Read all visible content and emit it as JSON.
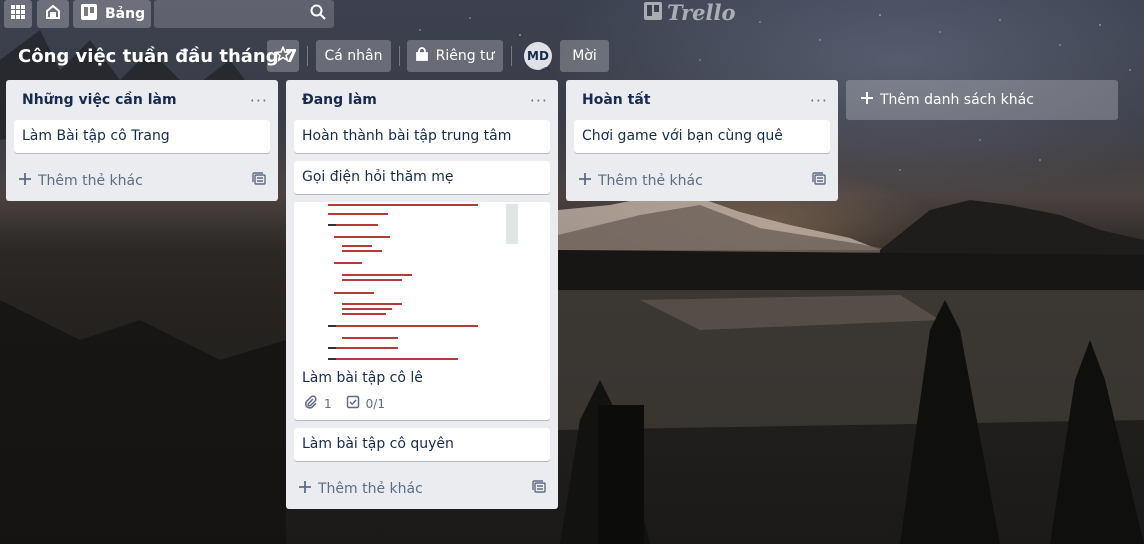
{
  "topbar": {
    "apps_icon": "grid-icon",
    "home_icon": "home-icon",
    "boards_label": "Bảng",
    "search_icon": "search-icon",
    "logo_text": "Trello"
  },
  "board": {
    "title": "Công việc tuần đầu tháng 7",
    "visibility_team_label": "Cá nhân",
    "visibility_private_label": "Riêng tư",
    "member_initials": "MD",
    "invite_label": "Mời"
  },
  "lists": [
    {
      "title": "Những việc cần làm",
      "menu": "···",
      "cards": [
        {
          "text": "Làm Bài tập cô Trang"
        }
      ],
      "add_card_label": "Thêm thẻ khác"
    },
    {
      "title": "Đang làm",
      "menu": "···",
      "cards": [
        {
          "text": "Hoàn thành bài tập trung tâm"
        },
        {
          "text": "Gọi điện hỏi thăm mẹ"
        },
        {
          "text": "Làm bài tập cô lê",
          "attachments": "1",
          "checklist": "0/1"
        },
        {
          "text": "Làm bài tập cô quyên"
        }
      ],
      "add_card_label": "Thêm thẻ khác"
    },
    {
      "title": "Hoàn tất",
      "menu": "···",
      "cards": [
        {
          "text": "Chơi game với bạn cùng quê"
        }
      ],
      "add_card_label": "Thêm thẻ khác"
    }
  ],
  "add_list_label": "Thêm danh sách khác"
}
